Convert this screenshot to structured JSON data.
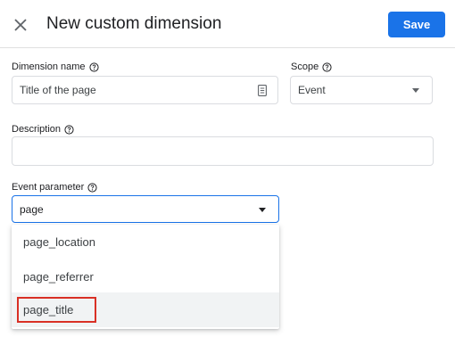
{
  "header": {
    "title": "New custom dimension",
    "save_label": "Save",
    "close_icon": "close-icon"
  },
  "dimension_name": {
    "label": "Dimension name",
    "value": "Title of the page",
    "icon": "document-icon"
  },
  "scope": {
    "label": "Scope",
    "value": "Event"
  },
  "description": {
    "label": "Description",
    "value": ""
  },
  "event_parameter": {
    "label": "Event parameter",
    "value": "page",
    "options": [
      {
        "label": "page_location"
      },
      {
        "label": "page_referrer"
      },
      {
        "label": "page_title"
      }
    ],
    "hovered_option": "page_title"
  },
  "colors": {
    "accent": "#1a73e8",
    "highlight_box": "#d93025",
    "hover_bg": "#f1f3f4"
  }
}
